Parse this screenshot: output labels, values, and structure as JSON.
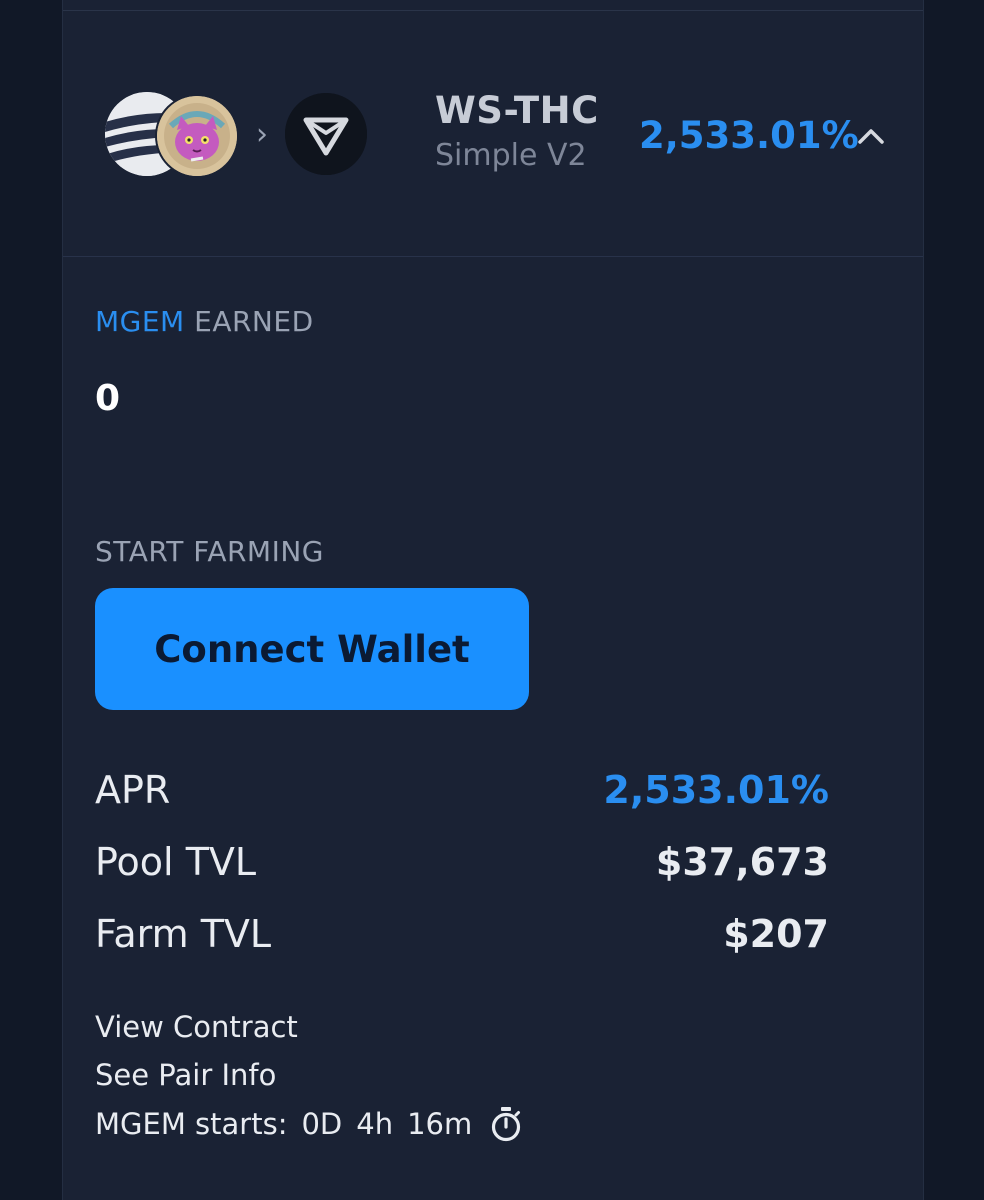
{
  "header": {
    "pair_name": "WS-THC",
    "pair_subtitle": "Simple V2",
    "apr": "2,533.01%",
    "separator": "›",
    "icons": [
      "wave-token-icon",
      "cat-token-icon",
      "chevron-right-icon",
      "v-logo-token-icon",
      "chevron-up-icon"
    ]
  },
  "earned": {
    "token": "MGEM",
    "label": "EARNED",
    "value": "0"
  },
  "farming": {
    "label": "START FARMING",
    "button_label": "Connect Wallet"
  },
  "stats": [
    {
      "label": "APR",
      "value": "2,533.01%"
    },
    {
      "label": "Pool TVL",
      "value": "$37,673"
    },
    {
      "label": "Farm TVL",
      "value": "$207"
    }
  ],
  "links": {
    "view_contract": "View Contract",
    "pair_info": "See Pair Info"
  },
  "countdown": {
    "label": "MGEM starts:",
    "days": "0D",
    "hours": "4h",
    "minutes": "16m",
    "icon": "stopwatch-icon"
  },
  "colors": {
    "accent": "#2a8ef0",
    "button": "#1a90ff",
    "card": "#1a2234",
    "page": "#111827"
  }
}
